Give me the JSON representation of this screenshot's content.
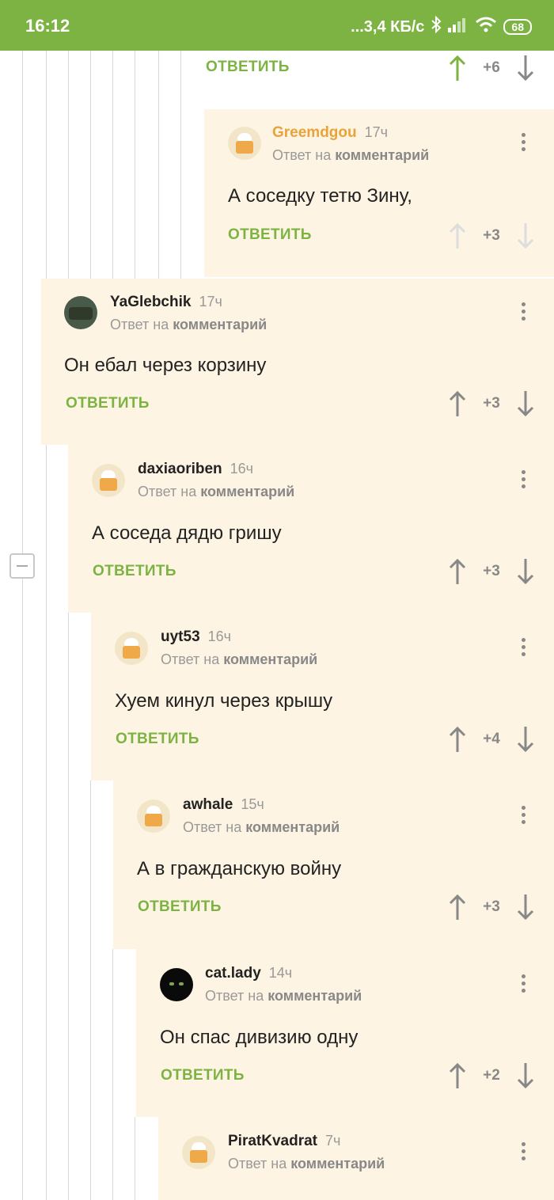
{
  "status": {
    "time": "16:12",
    "speed": "...3,4 КБ/с",
    "battery": "68"
  },
  "labels": {
    "reply": "ОТВЕТИТЬ",
    "reply_to_prefix": "Ответ на",
    "reply_to_target": "комментарий"
  },
  "top_partial": {
    "score": "+6"
  },
  "comments": [
    {
      "author": "Greemdgou",
      "time": "17ч",
      "text": "А соседку тетю Зину,",
      "score": "+3"
    },
    {
      "author": "YaGlebchik",
      "time": "17ч",
      "text": "Он ебал через корзину",
      "score": "+3"
    },
    {
      "author": "daxiaoriben",
      "time": "16ч",
      "text": "А соседа дядю гришу",
      "score": "+3"
    },
    {
      "author": "uyt53",
      "time": "16ч",
      "text": "Хуем кинул через крышу",
      "score": "+4"
    },
    {
      "author": "awhale",
      "time": "15ч",
      "text": "А в гражданскую войну",
      "score": "+3"
    },
    {
      "author": "cat.lady",
      "time": "14ч",
      "text": "Он спас дивизию одну",
      "score": "+2"
    },
    {
      "author": "PiratKvadrat",
      "time": "7ч",
      "text": "",
      "score": ""
    }
  ],
  "colors": {
    "accent": "#7cb342",
    "comment_bg": "#fdf4e3",
    "author_highlight": "#e8a43a"
  }
}
